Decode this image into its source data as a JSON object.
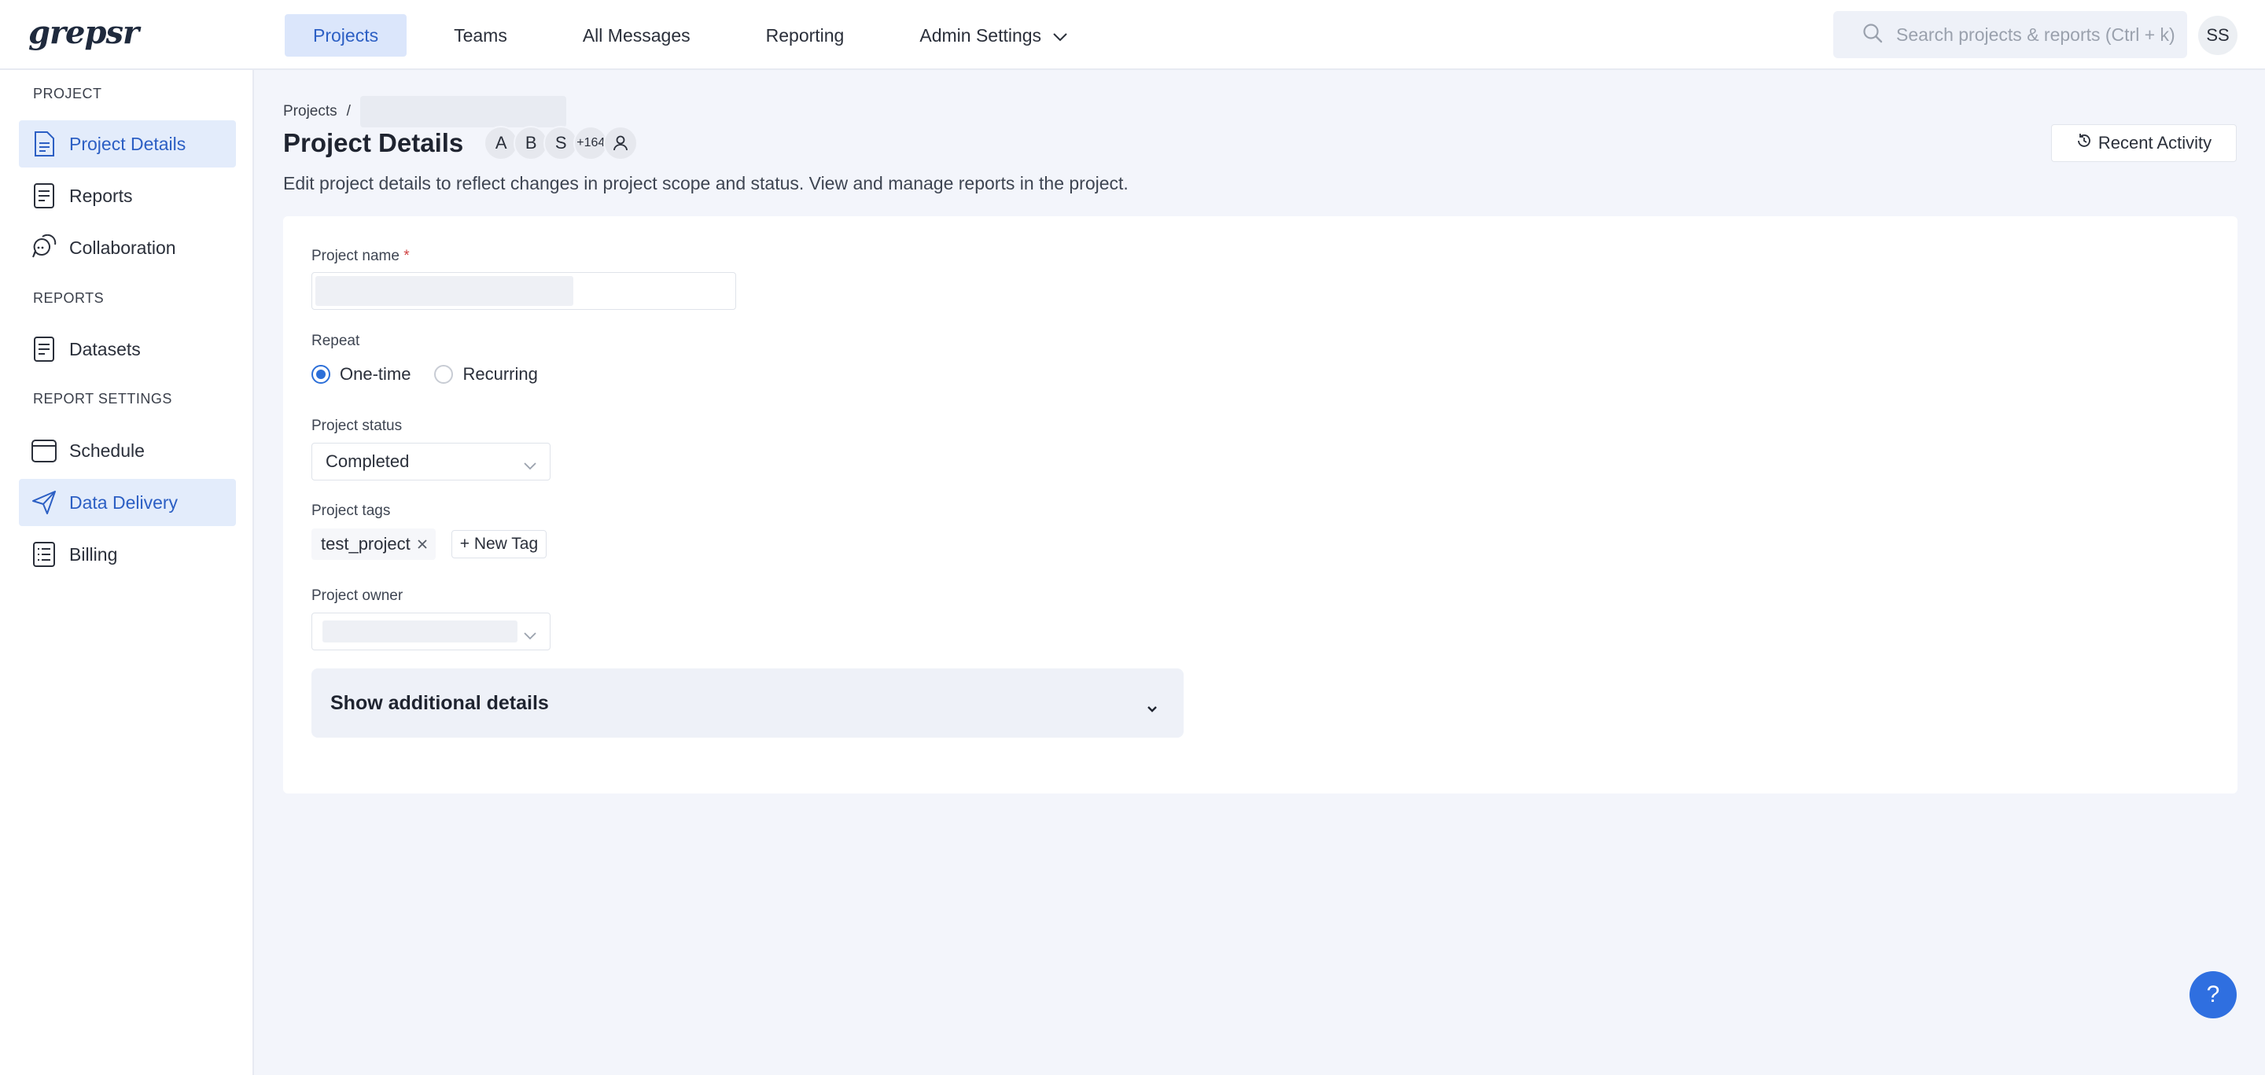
{
  "app": {
    "logo": "grepsr"
  },
  "nav": {
    "items": [
      {
        "label": "Projects",
        "active": true
      },
      {
        "label": "Teams"
      },
      {
        "label": "All Messages"
      },
      {
        "label": "Reporting"
      },
      {
        "label": "Admin Settings"
      }
    ]
  },
  "search": {
    "placeholder": "Search projects & reports (Ctrl + k)"
  },
  "user": {
    "initials": "SS"
  },
  "sidebar": {
    "sections": {
      "project": "PROJECT",
      "reports": "REPORTS",
      "report_settings": "REPORT SETTINGS"
    },
    "items": [
      {
        "label": "Project Details",
        "icon": "document-icon",
        "active": true
      },
      {
        "label": "Reports",
        "icon": "report-icon"
      },
      {
        "label": "Collaboration",
        "icon": "chat-bubbles-icon"
      },
      {
        "label": "Datasets",
        "icon": "dataset-icon"
      },
      {
        "label": "Schedule",
        "icon": "calendar-icon"
      },
      {
        "label": "Data Delivery",
        "icon": "paper-plane-icon",
        "active": true
      },
      {
        "label": "Billing",
        "icon": "billing-list-icon"
      }
    ]
  },
  "breadcrumb": {
    "root": "Projects",
    "separator": "/"
  },
  "page": {
    "title": "Project Details",
    "members": [
      "A",
      "B",
      "S",
      "+164"
    ],
    "description": "Edit project details to reflect changes in project scope and status. View and manage reports in the project.",
    "recent_activity": "Recent Activity"
  },
  "form": {
    "name_label": "Project name",
    "required_mark": "*",
    "repeat_label": "Repeat",
    "repeat_options": [
      "One-time",
      "Recurring"
    ],
    "repeat_selected": "One-time",
    "status_label": "Project status",
    "status_value": "Completed",
    "tags_label": "Project tags",
    "tags": [
      "test_project"
    ],
    "new_tag": "+ New Tag",
    "owner_label": "Project owner",
    "additional_details": "Show additional details"
  },
  "help": {
    "label": "?"
  },
  "colors": {
    "accent": "#2c6fd8",
    "active_bg": "#e3ecfb",
    "page_bg": "#f3f5fb"
  }
}
